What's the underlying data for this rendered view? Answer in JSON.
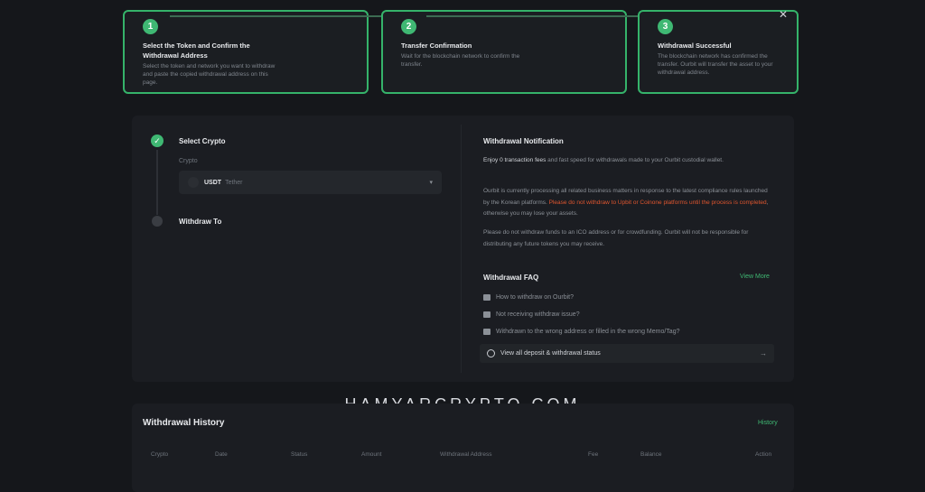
{
  "steps": [
    {
      "num": "1",
      "title": "Select the Token and Confirm the Withdrawal Address",
      "desc": "Select the token and network you want to withdraw and paste the copied withdrawal address on this page."
    },
    {
      "num": "2",
      "title": "Transfer Confirmation",
      "desc": "Wait for the blockchain network to confirm the transfer."
    },
    {
      "num": "3",
      "title": "Withdrawal Successful",
      "desc": "The blockchain network has confirmed the transfer. Ourbit will transfer the asset to your withdrawal address."
    }
  ],
  "close_symbol": "✕",
  "check_symbol": "✓",
  "form": {
    "select_crypto_label": "Select Crypto",
    "crypto_field_label": "Crypto",
    "selected_coin": "USDT",
    "selected_coin_name": "Tether",
    "withdraw_to_label": "Withdraw To"
  },
  "notification": {
    "title": "Withdrawal Notification",
    "p1_bold": "Enjoy 0 transaction fees",
    "p1_rest": " and fast speed for withdrawals made to your Ourbit custodial wallet.",
    "p2_start": "Ourbit is currently processing all related business matters in response to the latest compliance rules launched by the Korean platforms. ",
    "p2_red": "Please do not withdraw to Upbit or Coinone platforms until the process is completed",
    "p2_end": ", otherwise you may lose your assets.",
    "p3": "Please do not withdraw funds to an ICO address or for crowdfunding. Ourbit will not be responsible for distributing any future tokens you may receive."
  },
  "faq": {
    "title": "Withdrawal FAQ",
    "view_more": "View More",
    "items": [
      "How to withdraw on Ourbit?",
      "Not receiving withdraw issue?",
      "Withdrawn to the wrong address or filled in the wrong Memo/Tag?"
    ],
    "status_link": "View all deposit & withdrawal status"
  },
  "watermark": "HAMYARCRYPTO.COM",
  "history": {
    "title": "Withdrawal History",
    "link": "History",
    "columns": [
      "Crypto",
      "Date",
      "Status",
      "Amount",
      "Withdrawal Address",
      "Fee",
      "Balance",
      "Action"
    ]
  },
  "colors": {
    "accent": "#3fb873",
    "warning": "#e0562f",
    "background": "#15171b"
  }
}
